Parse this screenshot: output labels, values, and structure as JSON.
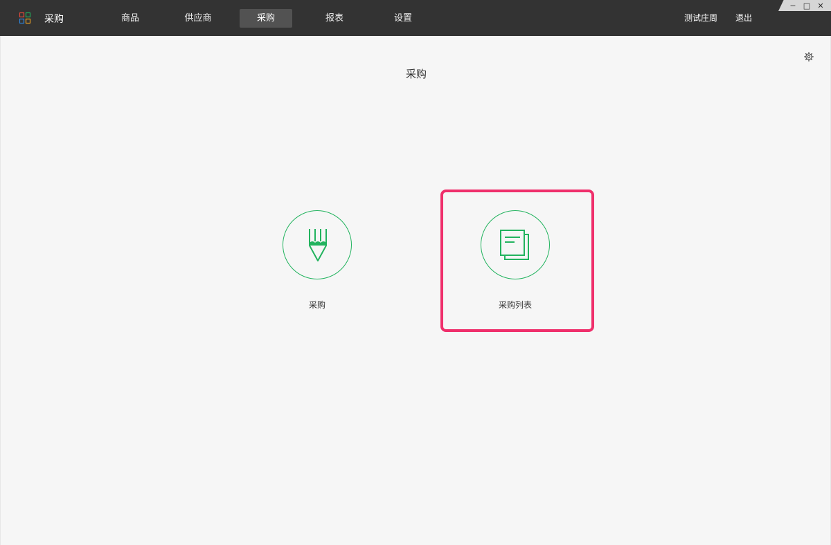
{
  "app": {
    "title": "采购"
  },
  "nav": {
    "items": [
      {
        "label": "商品"
      },
      {
        "label": "供应商"
      },
      {
        "label": "采购"
      },
      {
        "label": "报表"
      },
      {
        "label": "设置"
      }
    ],
    "active_index": 2
  },
  "header": {
    "user_name": "测试庄周",
    "logout_label": "退出"
  },
  "window_controls": {
    "minimize": "−",
    "maximize": "□",
    "close": "✕"
  },
  "main": {
    "title": "采购",
    "cards": [
      {
        "label": "采购",
        "icon": "pencil-icon"
      },
      {
        "label": "采购列表",
        "icon": "document-list-icon"
      }
    ]
  },
  "colors": {
    "accent": "#22b35e",
    "topbar": "#333333",
    "highlight": "#ef2f6b",
    "logo": [
      "#e64a3b",
      "#22b35e",
      "#2e86de",
      "#f5a623"
    ]
  }
}
